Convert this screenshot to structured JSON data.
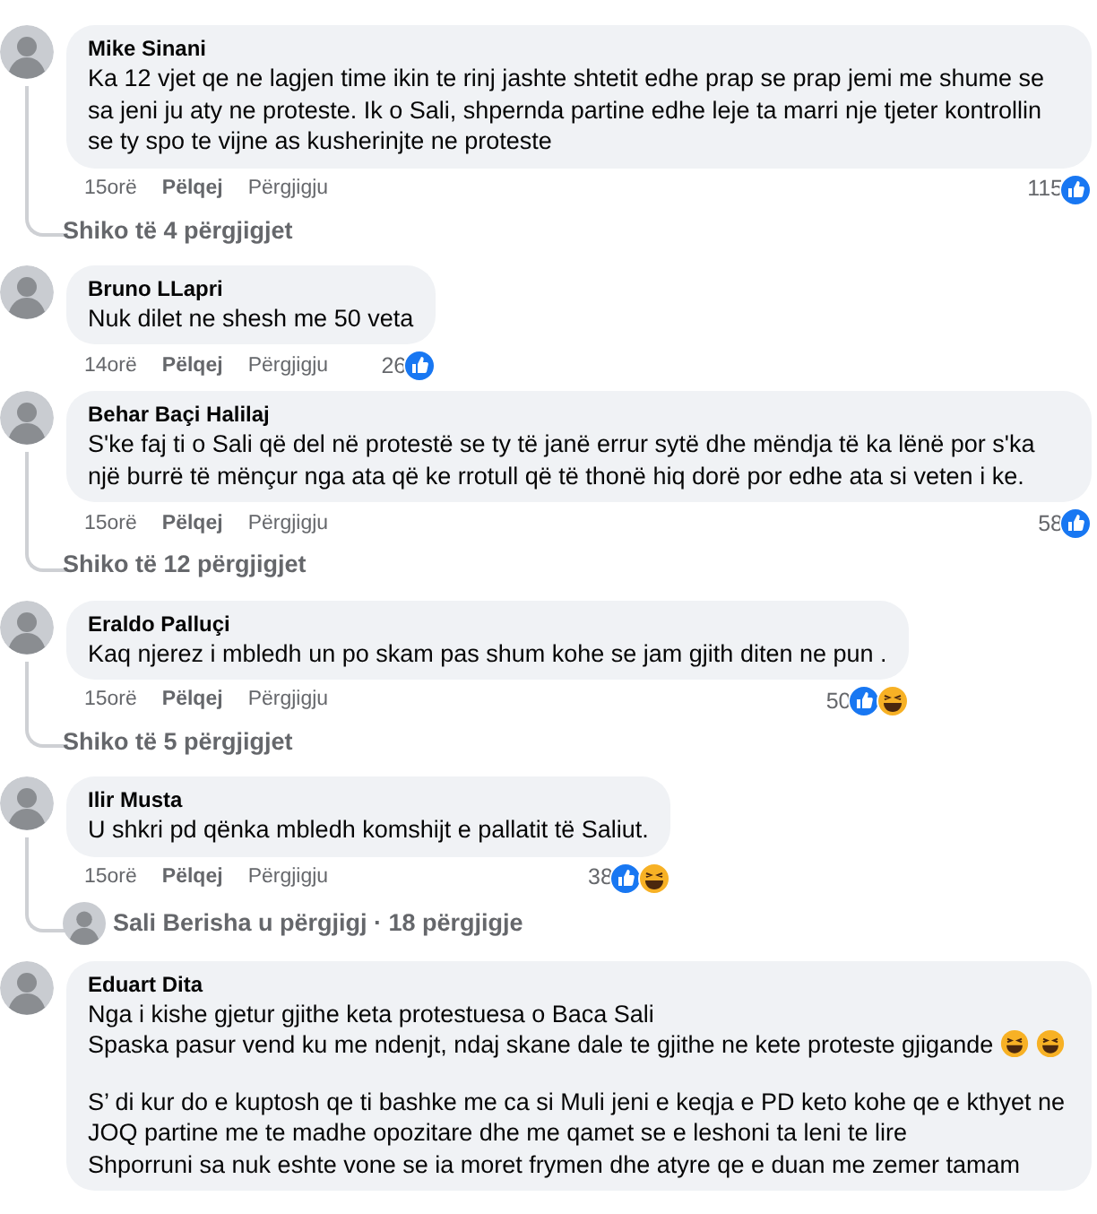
{
  "comments": [
    {
      "author": "Mike Sinani",
      "paragraphs": [
        [
          {
            "text": "Ka 12 vjet qe ne lagjen time ikin te rinj jashte shtetit edhe prap se prap jemi me shume se sa jeni ju aty ne proteste. Ik o Sali, shpernda partine edhe leje ta marri nje tjeter kontrollin se ty spo te vijne as kusherinjte ne proteste"
          }
        ]
      ],
      "time": "15orë",
      "like": "Pëlqej",
      "reply": "Përgjigju",
      "count": "115",
      "reactions": [
        {
          "kind": "like"
        }
      ],
      "replies": {
        "kind": "link",
        "text": "Shiko të 4 përgjigjet"
      }
    },
    {
      "author": "Bruno LLapri",
      "paragraphs": [
        [
          {
            "text": "Nuk dilet ne shesh me 50 veta"
          }
        ]
      ],
      "time": "14orë",
      "like": "Pëlqej",
      "reply": "Përgjigju",
      "count": "26",
      "reactions": [
        {
          "kind": "like"
        }
      ]
    },
    {
      "author": "Behar Baçi Halilaj",
      "paragraphs": [
        [
          {
            "text": "S'ke faj ti o Sali që del në protestë se ty të janë errur sytë dhe mëndja të ka lënë por s'ka një burrë të mënçur nga ata që ke rrotull që të thonë hiq dorë por edhe ata si veten i ke."
          }
        ]
      ],
      "time": "15orë",
      "like": "Pëlqej",
      "reply": "Përgjigju",
      "count": "58",
      "reactions": [
        {
          "kind": "like"
        }
      ],
      "replies": {
        "kind": "link",
        "text": "Shiko të 12 përgjigjet"
      }
    },
    {
      "author": "Eraldo Palluçi",
      "paragraphs": [
        [
          {
            "text": "Kaq njerez i mbledh un po skam pas shum kohe se jam gjith diten ne pun ."
          }
        ]
      ],
      "time": "15orë",
      "like": "Pëlqej",
      "reply": "Përgjigju",
      "count": "50",
      "reactions": [
        {
          "kind": "like"
        },
        {
          "kind": "haha"
        }
      ],
      "replies": {
        "kind": "link",
        "text": "Shiko të 5 përgjigjet"
      }
    },
    {
      "author": "Ilir Musta",
      "paragraphs": [
        [
          {
            "text": "U shkri pd qënka mbledh komshijt e pallatit të Saliut."
          }
        ]
      ],
      "time": "15orë",
      "like": "Pëlqej",
      "reply": "Përgjigju",
      "count": "38",
      "reactions": [
        {
          "kind": "like"
        },
        {
          "kind": "haha"
        }
      ],
      "replies": {
        "kind": "author",
        "text": "Sali Berisha u përgjigj · 18 përgjigje"
      }
    },
    {
      "author": "Eduart Dita",
      "paragraphs": [
        [
          {
            "text": "Nga i kishe gjetur gjithe keta protestuesa o Baca Sali"
          },
          {
            "text": "Spaska pasur vend ku me ndenjt, ndaj skane dale te gjithe ne kete proteste gjigande",
            "emojis": [
              {
                "kind": "laugh"
              },
              {
                "kind": "laugh"
              }
            ]
          }
        ],
        [
          {
            "text": "S’ di kur do e kuptosh qe ti bashke me ca si Muli jeni e keqja e PD keto kohe qe e kthyet ne JOQ partine me te madhe opozitare dhe me qamet se e leshoni ta leni te lire"
          },
          {
            "text": "Shporruni sa nuk eshte vone se ia moret frymen dhe atyre qe e duan me zemer tamam"
          }
        ]
      ]
    }
  ]
}
